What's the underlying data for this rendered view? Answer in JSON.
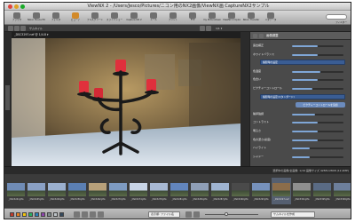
{
  "window": {
    "title": "ViewNX 2 - /Users/Jesco/Pictures/ニコン用のNX2画像/ViewNX画 CaptureNX2サンプル"
  },
  "toolbar": {
    "items": [
      {
        "label": "ブラウザ",
        "icon": "browser-icon"
      },
      {
        "label": "Nikon Movie Editor",
        "icon": "movie-editor-icon"
      },
      {
        "label": "フォルダ",
        "icon": "folder-icon"
      },
      {
        "label": "ビューア",
        "icon": "viewer-icon"
      },
      {
        "label": "フルスクリーン",
        "icon": "fullscreen-icon"
      },
      {
        "label": "スライドショー",
        "icon": "slideshow-icon"
      },
      {
        "label": "Capture NX 2",
        "icon": "capture-nx-icon"
      },
      {
        "label": "メール",
        "icon": "mail-icon"
      },
      {
        "label": "プリント",
        "icon": "print-icon"
      },
      {
        "label": "FTP",
        "icon": "ftp-icon"
      },
      {
        "label": "my Picturetown",
        "icon": "picturetown-icon"
      },
      {
        "label": "ViewNX 2 Upload",
        "icon": "upload-icon"
      },
      {
        "label": "Nikon Transfer",
        "icon": "transfer-icon"
      },
      {
        "label": "メタデータ",
        "icon": "metadata-icon"
      }
    ],
    "search_label": "フィルター",
    "accent_color": "#d28a2a"
  },
  "subbar": {
    "view_label": "サムネイル",
    "zoom_readout": "1/1 ▾"
  },
  "photo": {
    "filename": "_DSC3297.nef  @ 1/4.8 ▾",
    "colors": {
      "candle": "#e0303c",
      "wall": "#c9a86a",
      "metal": "#1a1a1a"
    }
  },
  "panel": {
    "title": "画像調整",
    "rows": [
      {
        "label": "露出補正",
        "kind": "slider",
        "level": 0.5
      },
      {
        "label": "ホワイトバランス",
        "kind": "slider",
        "level": 0.5
      },
      {
        "label": "撮影時の設定",
        "kind": "select"
      },
      {
        "label": "色温度",
        "kind": "slider",
        "level": 0.55
      },
      {
        "label": "色合い",
        "kind": "slider",
        "level": 0.5
      },
      {
        "label": "ピクチャーコントロール",
        "kind": "slider",
        "level": 0.4
      },
      {
        "label": "撮影時の設定(スタンダード)",
        "kind": "select"
      },
      {
        "label": "ピクチャーコントロールを追加",
        "kind": "button"
      },
      {
        "label": "輪郭強調",
        "kind": "slider",
        "level": 0.45
      },
      {
        "label": "コントラスト",
        "kind": "slider",
        "level": 0.5
      },
      {
        "label": "明るさ",
        "kind": "slider",
        "level": 0.5
      },
      {
        "label": "色の濃さ(彩度)",
        "kind": "slider",
        "level": 0.5
      },
      {
        "label": "ハイライト",
        "kind": "slider",
        "level": 0.35
      },
      {
        "label": "シャドー",
        "kind": "slider",
        "level": 0.35
      }
    ]
  },
  "filmstrip": {
    "caption": "選択中の画像/全画像: 1/19  画像サイズ 4288×2848 (12.2MP)",
    "thumbs": [
      {
        "label": "_DSC3241.JPG",
        "tone": "#6f8bb5"
      },
      {
        "label": "_DSC3245.JPG",
        "tone": "#8aa0c4"
      },
      {
        "label": "_DSC3249.JPG",
        "tone": "#9bb0cf"
      },
      {
        "label": "_DSC3256.JPG",
        "tone": "#5b7fb3"
      },
      {
        "label": "_DSC3262.JPG",
        "tone": "#b7a07a"
      },
      {
        "label": "_DSC3270.JPG",
        "tone": "#7e9bc2"
      },
      {
        "label": "_DSC3274.JPG",
        "tone": "#c8d4e6"
      },
      {
        "label": "_DSC3278.JPG",
        "tone": "#a8b9d4"
      },
      {
        "label": "_DSC3281.JPG",
        "tone": "#6285bd"
      },
      {
        "label": "_DSC3284.JPG",
        "tone": "#8f9fb7"
      },
      {
        "label": "_DSC3287.JPG",
        "tone": "#9fb4d1"
      },
      {
        "label": "_DSC3290.JPG",
        "tone": "#4a4a4a"
      },
      {
        "label": "_DSC3293.JPG",
        "tone": "#7691bb"
      },
      {
        "label": "_DSC3297.nef",
        "tone": "#8c6d4b",
        "selected": true
      },
      {
        "label": "_DSC3301.JPG",
        "tone": "#8f8f8f"
      },
      {
        "label": "_DSC3305.JPG",
        "tone": "#5a6b84"
      },
      {
        "label": "_DSC3309.JPG",
        "tone": "#6d7f9b"
      }
    ]
  },
  "bottombar": {
    "label_colors": [
      "#c0392b",
      "#e67e22",
      "#f1c40f",
      "#27ae60",
      "#2980b9",
      "#8e44ad",
      "#7f8c8d",
      "#bdc3c7",
      "#34495e"
    ],
    "sort_select": "表示順: ファイル名",
    "size_select": "サムネイルを作成",
    "zoom_level": 0.4
  }
}
